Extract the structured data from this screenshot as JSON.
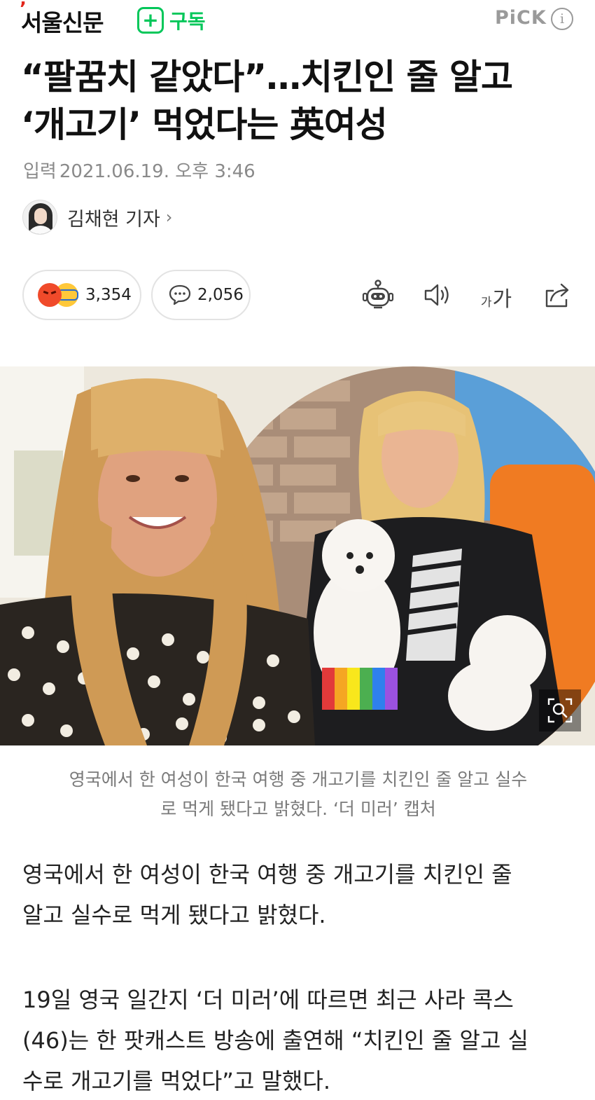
{
  "header": {
    "press_name": "서울신문",
    "subscribe_icon": "plus-icon",
    "subscribe_label": "구독",
    "pick_label": "PiCK",
    "info_label": "i"
  },
  "article": {
    "headline_line1": "“팔꿈치 같았다”…치킨인 줄 알고",
    "headline_line2": "‘개고기’ 먹었다는 英여성",
    "date_label": "입력",
    "date_value": "2021.06.19. 오후 3:46",
    "reporter_name": "김채현 기자",
    "reporter_chevron": "›"
  },
  "actions": {
    "reaction_count": "3,354",
    "comment_count": "2,056",
    "font_small": "가",
    "font_large": "가",
    "icons": [
      "robot-icon",
      "speaker-icon",
      "font-size-icon",
      "share-icon",
      "comment-icon",
      "zoom-icon"
    ]
  },
  "photo": {
    "caption_line1": "영국에서 한 여성이 한국 여행 중 개고기를 치킨인 줄 알고 실수",
    "caption_line2": "로 먹게 됐다고 밝혔다. ‘더 미러’ 캡처"
  },
  "body": {
    "para1_line1": "영국에서 한 여성이 한국 여행 중 개고기를 치킨인 줄",
    "para1_line2": "알고 실수로 먹게 됐다고 밝혔다.",
    "para2_line1": "19일 영국 일간지 ‘더 미러’에 따르면 최근 사라 콕스",
    "para2_line2": "(46)는 한 팟캐스트 방송에 출연해 “치킨인 줄 알고 실",
    "para2_line3": "수로 개고기를 먹었다”고 말했다."
  },
  "colors": {
    "brand_green": "#03c75a",
    "logo_red": "#e2261c",
    "meta_gray": "#8a8a8a"
  }
}
